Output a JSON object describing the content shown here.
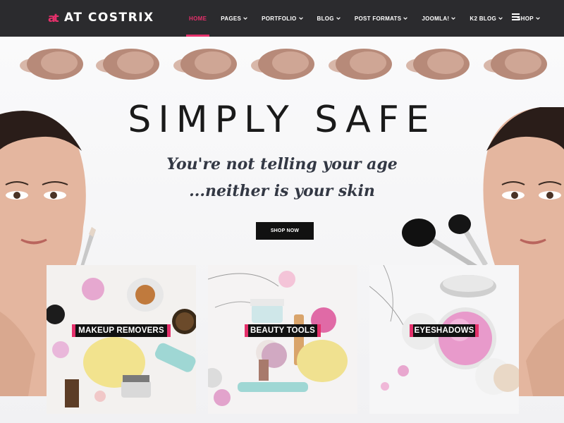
{
  "brand": {
    "logo_text": "AT COSTRIX",
    "accent_color": "#e5306b"
  },
  "nav": {
    "items": [
      {
        "label": "HOME",
        "active": true,
        "dropdown": false
      },
      {
        "label": "PAGES",
        "active": false,
        "dropdown": true
      },
      {
        "label": "PORTFOLIO",
        "active": false,
        "dropdown": true
      },
      {
        "label": "BLOG",
        "active": false,
        "dropdown": true
      },
      {
        "label": "POST FORMATS",
        "active": false,
        "dropdown": true
      },
      {
        "label": "JOOMLA!",
        "active": false,
        "dropdown": true
      },
      {
        "label": "K2 BLOG",
        "active": false,
        "dropdown": true
      },
      {
        "label": "SHOP",
        "active": false,
        "dropdown": true
      }
    ],
    "menu_icon": "hamburger-icon"
  },
  "hero": {
    "headline": "SIMPLY SAFE",
    "tagline_line1": "You're not telling your age",
    "tagline_line2": "...neither is your skin",
    "button_label": "SHOP NOW"
  },
  "categories": [
    {
      "label": "MAKEUP REMOVERS"
    },
    {
      "label": "BEAUTY TOOLS"
    },
    {
      "label": "EYESHADOWS"
    }
  ]
}
